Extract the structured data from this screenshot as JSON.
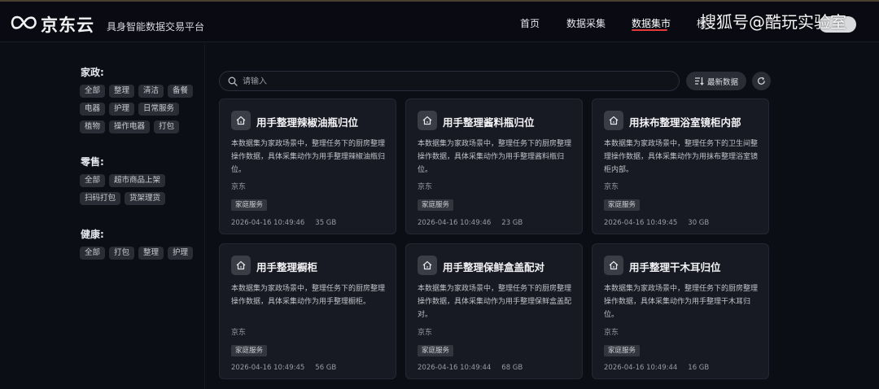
{
  "header": {
    "logo_text": "京东云",
    "subtitle": "具身智能数据交易平台",
    "nav": [
      "首页",
      "数据采集",
      "数据集市",
      "榜"
    ],
    "active_nav": "数据集市",
    "accent_color": "#e23a3a",
    "watermark": "搜狐号@酷玩实验室"
  },
  "sidebar": {
    "categories": [
      {
        "title": "家政:",
        "rows": [
          [
            "全部",
            "整理",
            "清洁",
            "备餐"
          ],
          [
            "电器",
            "护理",
            "日常服务"
          ],
          [
            "植物",
            "操作电器",
            "打包"
          ]
        ]
      },
      {
        "title": "零售:",
        "rows": [
          [
            "全部",
            "超市商品上架"
          ],
          [
            "扫码打包",
            "货架理货"
          ]
        ]
      },
      {
        "title": "健康:",
        "rows": [
          [
            "全部",
            "打包",
            "整理",
            "护理"
          ]
        ]
      }
    ]
  },
  "toolbar": {
    "search_placeholder": "请输入",
    "sort_label": "最新数据"
  },
  "cards": [
    {
      "title": "用手整理辣椒油瓶归位",
      "desc": "本数据集为家政场景中，整理任务下的厨房整理操作数据，具体采集动作为用手整理辣椒油瓶归位。",
      "source": "京东",
      "tag": "家庭服务",
      "date": "2026-04-16 10:49:46",
      "size": "35 GB"
    },
    {
      "title": "用手整理酱料瓶归位",
      "desc": "本数据集为家政场景中，整理任务下的厨房整理操作数据，具体采集动作为用手整理酱料瓶归位。",
      "source": "京东",
      "tag": "家庭服务",
      "date": "2026-04-16 10:49:46",
      "size": "23 GB"
    },
    {
      "title": "用抹布整理浴室镜柜内部",
      "desc": "本数据集为家政场景中，整理任务下的卫生间整理操作数据，具体采集动作为用抹布整理浴室镜柜内部。",
      "source": "京东",
      "tag": "家庭服务",
      "date": "2026-04-16 10:49:45",
      "size": "30 GB"
    },
    {
      "title": "用手整理橱柜",
      "desc": "本数据集为家政场景中，整理任务下的厨房整理操作数据，具体采集动作为用手整理橱柜。",
      "source": "京东",
      "tag": "家庭服务",
      "date": "2026-04-16 10:49:45",
      "size": "56 GB"
    },
    {
      "title": "用手整理保鲜盒盖配对",
      "desc": "本数据集为家政场景中，整理任务下的厨房整理操作数据，具体采集动作为用手整理保鲜盒盖配对。",
      "source": "京东",
      "tag": "家庭服务",
      "date": "2026-04-16 10:49:44",
      "size": "68 GB"
    },
    {
      "title": "用手整理干木耳归位",
      "desc": "本数据集为家政场景中，整理任务下的厨房整理操作数据，具体采集动作为用手整理干木耳归位。",
      "source": "京东",
      "tag": "家庭服务",
      "date": "2026-04-16 10:49:44",
      "size": "16 GB"
    }
  ]
}
